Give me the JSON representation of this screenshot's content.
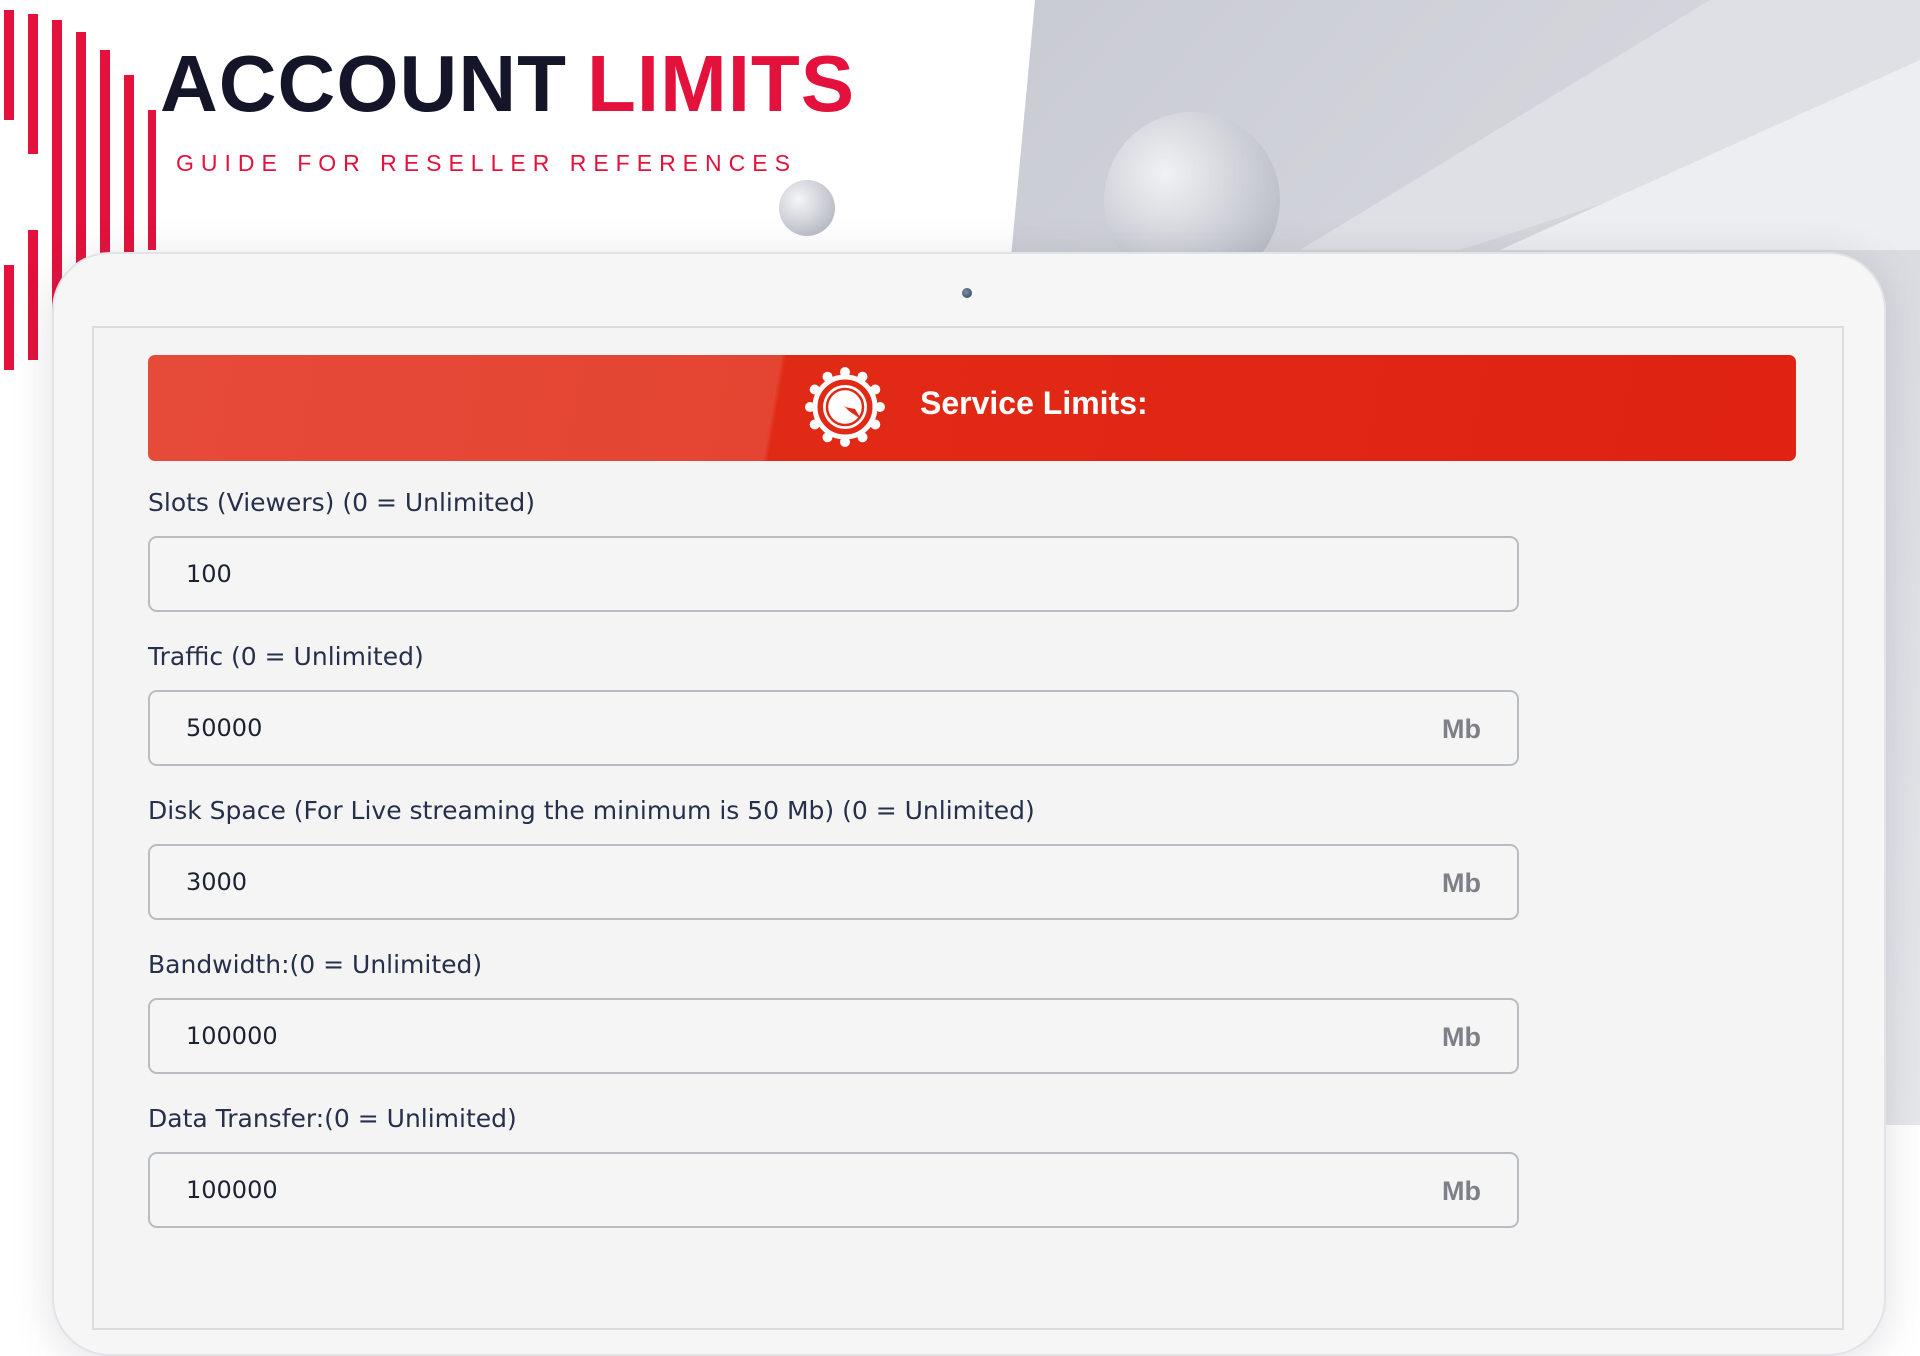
{
  "logo": {
    "word1": "ACCOUNT",
    "word2": "LIMITS",
    "subtitle": "GUIDE FOR RESELLER REFERENCES"
  },
  "colors": {
    "brand_red": "#e3113b",
    "brand_dark": "#141528",
    "banner_red": "#e12a16",
    "banner_orange": "#e64a39"
  },
  "panel": {
    "title": "Service Limits:",
    "icon": "gauge-icon"
  },
  "fields": [
    {
      "label": "Slots (Viewers) (0 = Unlimited)",
      "value": "100",
      "unit": ""
    },
    {
      "label": "Traffic (0 = Unlimited)",
      "value": "50000",
      "unit": "Mb"
    },
    {
      "label": "Disk Space (For Live streaming the minimum is 50 Mb) (0 = Unlimited)",
      "value": "3000",
      "unit": "Mb"
    },
    {
      "label": "Bandwidth:(0 = Unlimited)",
      "value": "100000",
      "unit": "Mb"
    },
    {
      "label": "Data Transfer:(0 = Unlimited)",
      "value": "100000",
      "unit": "Mb"
    }
  ]
}
